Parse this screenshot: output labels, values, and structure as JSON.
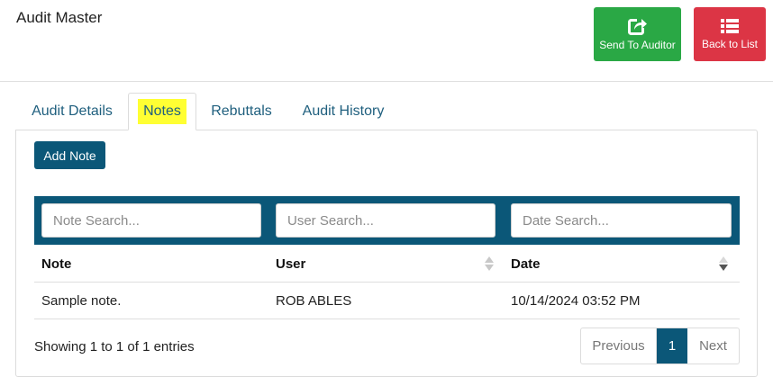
{
  "header": {
    "title": "Audit Master",
    "send_label": "Send To Auditor",
    "back_label": "Back to List",
    "send_color": "#2aa845",
    "back_color": "#dc3545"
  },
  "tabs": [
    {
      "label": "Audit Details"
    },
    {
      "label": "Notes",
      "active": true
    },
    {
      "label": "Rebuttals"
    },
    {
      "label": "Audit History"
    }
  ],
  "toolbar": {
    "add_note_label": "Add Note"
  },
  "search": {
    "note_placeholder": "Note Search...",
    "user_placeholder": "User Search...",
    "date_placeholder": "Date Search..."
  },
  "table": {
    "columns": [
      "Note",
      "User",
      "Date"
    ],
    "rows": [
      {
        "note": "Sample note.",
        "user": "ROB ABLES",
        "date": "10/14/2024 03:52 PM"
      }
    ]
  },
  "footer": {
    "info": "Showing 1 to 1 of 1 entries",
    "prev_label": "Previous",
    "page": "1",
    "next_label": "Next"
  },
  "colors": {
    "accent": "#0b5778",
    "highlight": "#ffff33"
  }
}
